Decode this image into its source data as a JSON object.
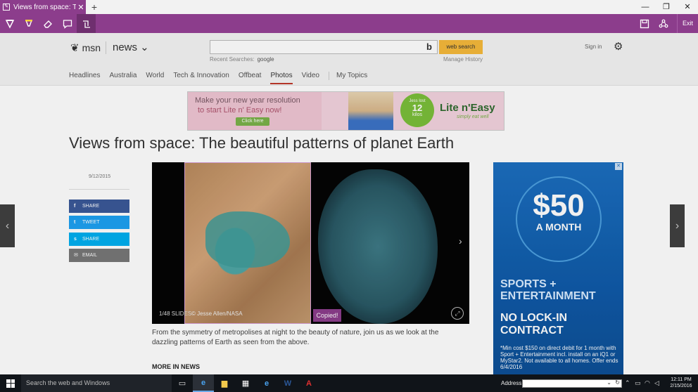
{
  "browser": {
    "tab_title": "Views from space: The b",
    "tab_close": "✕",
    "new_tab": "+",
    "window_controls": {
      "minimize": "—",
      "maximize": "❐",
      "close": "✕"
    }
  },
  "notes_toolbar": {
    "exit_label": "Exit"
  },
  "msn": {
    "logo_text": "msn",
    "section": "news ⌄",
    "search_button": "web search",
    "recent_label": "Recent Searches:",
    "recent_term": "google",
    "manage_history": "Manage History",
    "sign_in": "Sign in",
    "nav": [
      "Headlines",
      "Australia",
      "World",
      "Tech & Innovation",
      "Offbeat",
      "Photos",
      "Video",
      "My Topics"
    ],
    "active_nav": "Photos"
  },
  "banner_ad": {
    "line1": "Make your new year resolution",
    "line2": "to start Lite n' Easy now!",
    "button": "Click here",
    "circle_top": "Jess lost",
    "circle_num": "12",
    "circle_unit": "kilos",
    "brand": "Lite n'Easy",
    "brand_sub": "simply eat well"
  },
  "article": {
    "headline": "Views from space: The beautiful patterns of planet Earth",
    "date": "9/12/2015",
    "share_buttons": [
      {
        "icon": "f",
        "label": "SHARE",
        "color": "#3b5998"
      },
      {
        "icon": "t",
        "label": "TWEET",
        "color": "#1da1f2"
      },
      {
        "icon": "s",
        "label": "SHARE",
        "color": "#00aff0"
      },
      {
        "icon": "✉",
        "label": "EMAIL",
        "color": "#777777"
      }
    ],
    "slide_count": "1/48 SLIDES",
    "slide_credit": "© Jesse Allen/NASA",
    "copied_label": "Copied!",
    "description": "From the symmetry of metropolises at night to the beauty of nature, join us as we look at the dazzling patterns of Earth as seen from the above.",
    "more_heading": "MORE IN NEWS"
  },
  "side_ad": {
    "amount": "$50",
    "per": "A MONTH",
    "sports": "SPORTS + ENTERTAINMENT",
    "nolock": "NO LOCK-IN CONTRACT",
    "fine_print": "*Min cost $150 on direct debit for 1 month with Sport + Entertainment incl. install on an iQ1 or MyStar2. Not available to all homes. Offer ends 6/4/2016"
  },
  "taskbar": {
    "search_placeholder": "Search the web and Windows",
    "address_label": "Address",
    "time": "12:11 PM",
    "date": "2/15/2016"
  },
  "colors": {
    "accent": "#8c3d8c",
    "msn_search": "#f6b93b",
    "ad_blue": "#1c6fc0"
  }
}
